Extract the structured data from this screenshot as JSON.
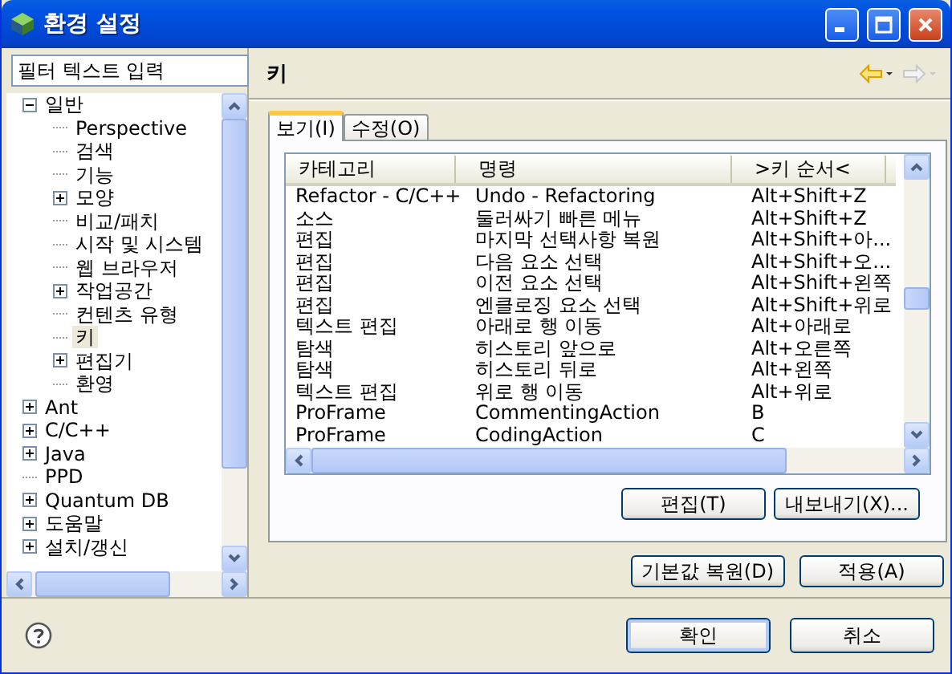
{
  "window": {
    "title": "환경 설정"
  },
  "filter": {
    "placeholder": "필터 텍스트 입력"
  },
  "tree": [
    {
      "label": "일반",
      "kind": "expanded",
      "selected": false,
      "children": [
        {
          "label": "Perspective",
          "kind": "leaf",
          "selected": false
        },
        {
          "label": "검색",
          "kind": "leaf",
          "selected": false
        },
        {
          "label": "기능",
          "kind": "leaf",
          "selected": false
        },
        {
          "label": "모양",
          "kind": "collapsed",
          "selected": false
        },
        {
          "label": "비교/패치",
          "kind": "leaf",
          "selected": false
        },
        {
          "label": "시작 및 시스템",
          "kind": "leaf",
          "selected": false
        },
        {
          "label": "웹 브라우저",
          "kind": "leaf",
          "selected": false
        },
        {
          "label": "작업공간",
          "kind": "collapsed",
          "selected": false
        },
        {
          "label": "컨텐츠 유형",
          "kind": "leaf",
          "selected": false
        },
        {
          "label": "키",
          "kind": "leaf",
          "selected": true
        },
        {
          "label": "편집기",
          "kind": "collapsed",
          "selected": false
        },
        {
          "label": "환영",
          "kind": "leaf",
          "selected": false
        }
      ]
    },
    {
      "label": "Ant",
      "kind": "collapsed",
      "selected": false
    },
    {
      "label": "C/C++",
      "kind": "collapsed",
      "selected": false
    },
    {
      "label": "Java",
      "kind": "collapsed",
      "selected": false
    },
    {
      "label": "PPD",
      "kind": "leaf",
      "selected": false
    },
    {
      "label": "Quantum DB",
      "kind": "collapsed",
      "selected": false
    },
    {
      "label": "도움말",
      "kind": "collapsed",
      "selected": false
    },
    {
      "label": "설치/갱신",
      "kind": "collapsed",
      "selected": false
    }
  ],
  "page": {
    "title": "키",
    "nav": [
      {
        "kind": "back",
        "disabled": false
      },
      {
        "kind": "forward",
        "disabled": true
      }
    ],
    "tabs": [
      {
        "label": "보기(I)",
        "selected": true
      },
      {
        "label": "수정(O)",
        "selected": false
      }
    ],
    "table": {
      "columns": [
        "카테고리",
        "명령",
        ">키 순서<"
      ],
      "rows": [
        [
          "Refactor - C/C++",
          "Undo - Refactoring",
          "Alt+Shift+Z"
        ],
        [
          "소스",
          "둘러싸기 빠른 메뉴",
          "Alt+Shift+Z"
        ],
        [
          "편집",
          "마지막 선택사항 복원",
          "Alt+Shift+아..."
        ],
        [
          "편집",
          "다음 요소 선택",
          "Alt+Shift+오..."
        ],
        [
          "편집",
          "이전 요소 선택",
          "Alt+Shift+왼쪽"
        ],
        [
          "편집",
          "엔클로징 요소 선택",
          "Alt+Shift+위로"
        ],
        [
          "텍스트 편집",
          "아래로 행 이동",
          "Alt+아래로"
        ],
        [
          "탐색",
          "히스토리 앞으로",
          "Alt+오른쪽"
        ],
        [
          "탐색",
          "히스토리 뒤로",
          "Alt+왼쪽"
        ],
        [
          "텍스트 편집",
          "위로 행 이동",
          "Alt+위로"
        ],
        [
          "ProFrame",
          "CommentingAction",
          "B"
        ],
        [
          "ProFrame",
          "CodingAction",
          "C"
        ]
      ]
    },
    "tab_buttons": [
      "편집(T)",
      "내보내기(X)..."
    ],
    "page_buttons": [
      "기본값 복원(D)",
      "적용(A)"
    ]
  },
  "buttons": [
    {
      "label": "확인",
      "default": true
    },
    {
      "label": "취소",
      "default": false
    }
  ]
}
